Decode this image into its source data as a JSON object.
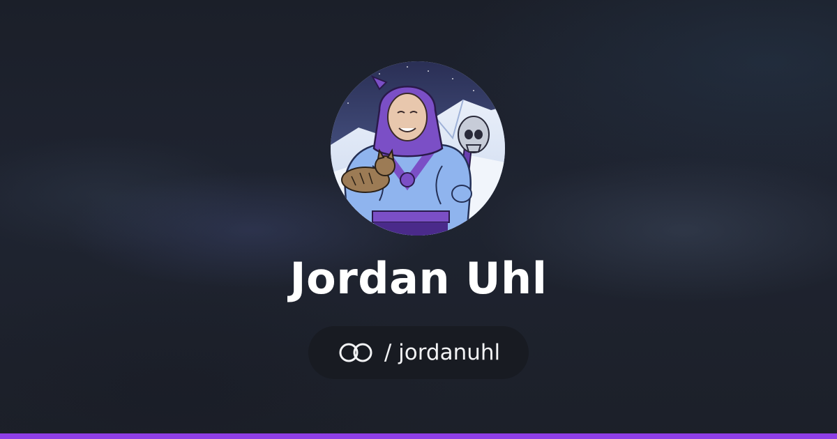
{
  "profile": {
    "name": "Jordan Uhl",
    "handle_separator": "/",
    "handle": "jordanuhl",
    "avatar_icon": "profile-illustration"
  },
  "brand": {
    "logo_icon": "linked-rings-icon"
  },
  "colors": {
    "background": "#1c202b",
    "name_text": "#ffffff",
    "pill_background": "#181b22",
    "pill_text": "#f2f3f5",
    "accent_bar": "#8e3ee6",
    "hood": "#7b4fc6",
    "skin_blue": "#8fb4ee"
  }
}
